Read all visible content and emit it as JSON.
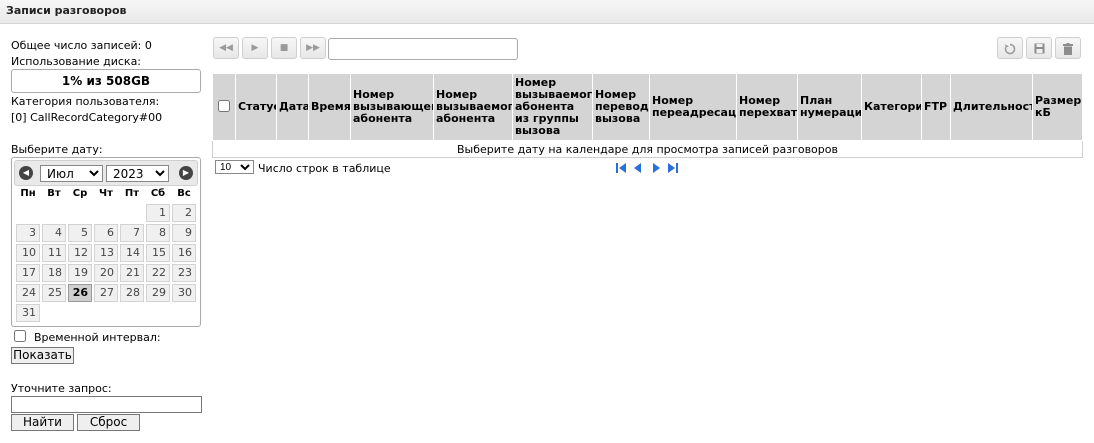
{
  "title": "Записи разговоров",
  "left": {
    "total_records": "Общее число записей: 0",
    "disk_usage_label": "Использование диска:",
    "disk_usage_value": "1% из 508GB",
    "disk_usage_fraction": 0.01,
    "user_category_label": "Категория пользователя:",
    "user_category_value": "[0] CallRecordCategory#00",
    "choose_date_label": "Выберите дату:",
    "time_interval_label": "Временной интервал:",
    "show_button": "Показать",
    "refine_label": "Уточните запрос:",
    "find_button": "Найти",
    "reset_button": "Сброс"
  },
  "calendar": {
    "month": "Июл",
    "year": "2023",
    "weekdays": [
      "Пн",
      "Вт",
      "Ср",
      "Чт",
      "Пт",
      "Сб",
      "Вс"
    ],
    "first_weekday_index": 5,
    "days_in_month": 31,
    "today": 26
  },
  "toolbar": {
    "search_value": "",
    "icons": [
      "first-record-icon",
      "play-icon",
      "stop-icon",
      "last-record-icon",
      "refresh-icon",
      "save-icon",
      "delete-icon"
    ]
  },
  "table": {
    "columns": [
      "Статус",
      "Дата",
      "Время",
      "Номер вызывающего абонента",
      "Номер вызываемого абонента",
      "Номер вызываемого абонента из группы вызова",
      "Номер перевода вызова",
      "Номер переадресации",
      "Номер перехвата",
      "План нумерации",
      "Категория",
      "FTP",
      "Длительность",
      "Размер, кБ"
    ],
    "empty_message": "Выберите дату на календаре для просмотра записей разговоров",
    "rows_per_page": "10",
    "rows_label": "Число строк в таблице"
  },
  "colors": {
    "header_bg": "#d4d4d4",
    "pager_blue": "#2a6edc"
  }
}
